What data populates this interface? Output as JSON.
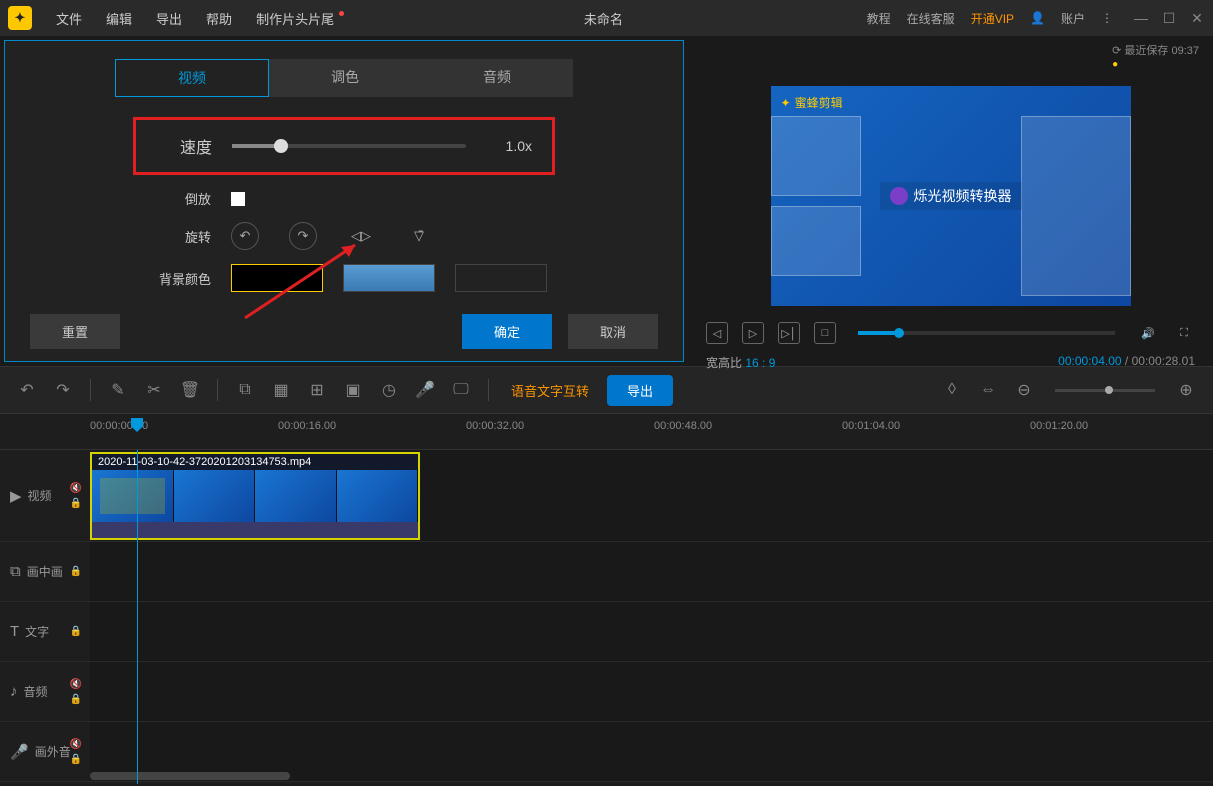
{
  "titlebar": {
    "menus": {
      "file": "文件",
      "edit": "编辑",
      "export": "导出",
      "help": "帮助",
      "make_titles": "制作片头片尾"
    },
    "title": "未命名",
    "right": {
      "tutorial": "教程",
      "support": "在线客服",
      "vip": "开通VIP",
      "account": "账户"
    }
  },
  "save": {
    "label": "最近保存 09:37"
  },
  "settings": {
    "tabs": {
      "video": "视频",
      "color": "调色",
      "audio": "音频"
    },
    "speed": {
      "label": "速度",
      "value": "1.0x"
    },
    "reverse": {
      "label": "倒放"
    },
    "rotate": {
      "label": "旋转"
    },
    "bgcolor": {
      "label": "背景颜色"
    },
    "buttons": {
      "reset": "重置",
      "ok": "确定",
      "cancel": "取消"
    }
  },
  "preview": {
    "watermark": "蜜蜂剪辑",
    "center_text": "烁光视频转换器",
    "aspect_label": "宽高比",
    "aspect_value": "16 : 9",
    "time_current": "00:00:04.00",
    "time_total": "00:00:28.01",
    "time_sep": "/"
  },
  "toolbar": {
    "voice_text": "语音文字互转",
    "export": "导出"
  },
  "timeline": {
    "marks": [
      "00:00:00.00",
      "00:00:16.00",
      "00:00:32.00",
      "00:00:48.00",
      "00:01:04.00",
      "00:01:20.00"
    ],
    "tracks": {
      "video": "视频",
      "pip": "画中画",
      "text": "文字",
      "audio": "音频",
      "voiceover": "画外音"
    },
    "clip_name": "2020-11-03-10-42-3720201203134753.mp4"
  }
}
